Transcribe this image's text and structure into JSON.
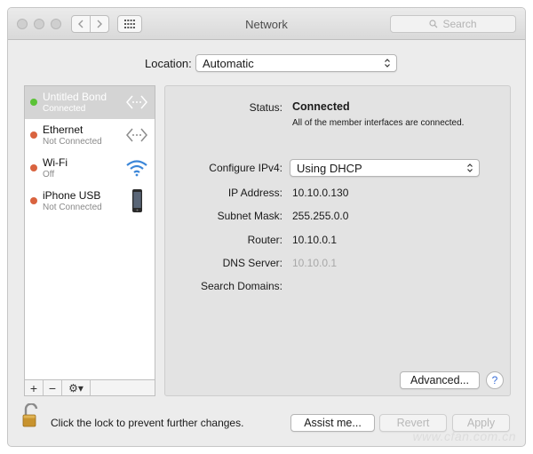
{
  "window": {
    "title": "Network",
    "search_placeholder": "Search"
  },
  "location": {
    "label": "Location:",
    "value": "Automatic"
  },
  "services": [
    {
      "name": "Untitled Bond",
      "status": "Connected",
      "status_color": "#5bc236",
      "selected": true,
      "icon": "bond-arrows-icon"
    },
    {
      "name": "Ethernet",
      "status": "Not Connected",
      "status_color": "#d9633f",
      "selected": false,
      "icon": "ethernet-arrows-icon"
    },
    {
      "name": "Wi-Fi",
      "status": "Off",
      "status_color": "#d9633f",
      "selected": false,
      "icon": "wifi-icon"
    },
    {
      "name": "iPhone USB",
      "status": "Not Connected",
      "status_color": "#d9633f",
      "selected": false,
      "icon": "iphone-icon"
    }
  ],
  "sidebar_tools": {
    "add": "+",
    "remove": "−",
    "gear": "⚙▾"
  },
  "details": {
    "status_label": "Status:",
    "status_value": "Connected",
    "status_note": "All of the member interfaces are connected.",
    "configure_label": "Configure IPv4:",
    "configure_value": "Using DHCP",
    "ip_label": "IP Address:",
    "ip_value": "10.10.0.130",
    "subnet_label": "Subnet Mask:",
    "subnet_value": "255.255.0.0",
    "router_label": "Router:",
    "router_value": "10.10.0.1",
    "dns_label": "DNS Server:",
    "dns_value": "10.10.0.1",
    "search_domains_label": "Search Domains:",
    "advanced_button": "Advanced...",
    "help_button": "?"
  },
  "footer": {
    "lock_text": "Click the lock to prevent further changes.",
    "assist_button": "Assist me...",
    "revert_button": "Revert",
    "apply_button": "Apply"
  },
  "watermark": "www.cfan.com.cn"
}
